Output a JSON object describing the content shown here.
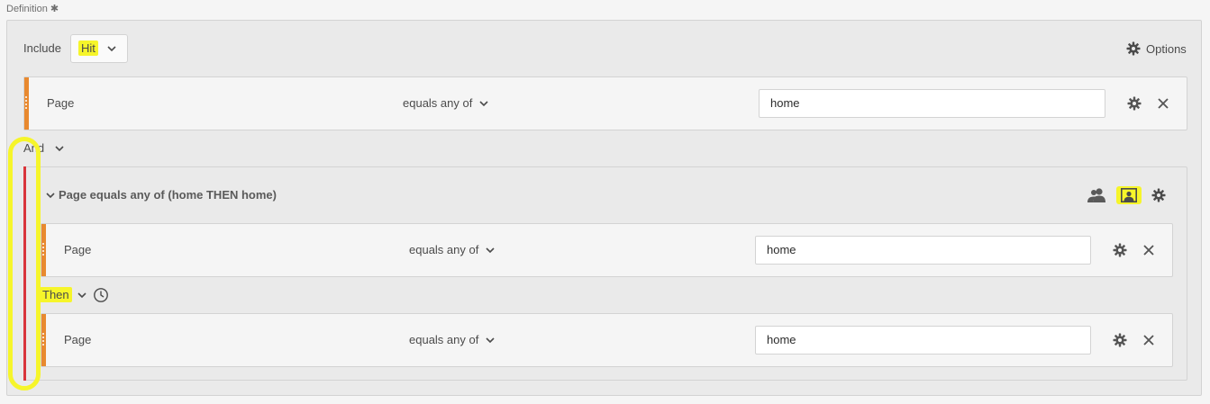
{
  "definition": {
    "label": "Definition ✱"
  },
  "top": {
    "include_label": "Include",
    "container_type": "Hit",
    "options_label": "Options"
  },
  "rule1": {
    "dimension": "Page",
    "operator": "equals any of",
    "value": "home"
  },
  "logic": {
    "and_label": "And",
    "then_label": "Then"
  },
  "sequence": {
    "title": "Page equals any of (home THEN home)",
    "rules": [
      {
        "dimension": "Page",
        "operator": "equals any of",
        "value": "home"
      },
      {
        "dimension": "Page",
        "operator": "equals any of",
        "value": "home"
      }
    ]
  },
  "icons": {
    "gear": "gear-icon",
    "close": "close-icon",
    "chevron": "chevron-down-icon",
    "clock": "clock-icon",
    "visitor": "visitor-icon",
    "visit": "visit-icon"
  },
  "colors": {
    "rule_bar": "#e8892f",
    "container_bar": "#d9353b",
    "highlight": "#f6f52a"
  }
}
